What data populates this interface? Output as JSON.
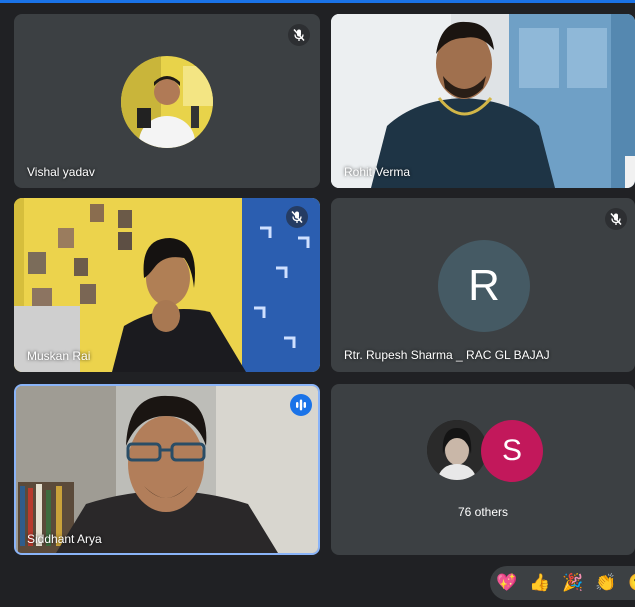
{
  "participants": {
    "vishal": {
      "name": "Vishal yadav",
      "muted": true
    },
    "rohit": {
      "name": "Rohit Verma"
    },
    "muskan": {
      "name": "Muskan Rai",
      "muted": true
    },
    "rupesh": {
      "name": "Rtr. Rupesh Sharma _ RAC GL BAJAJ",
      "initial": "R",
      "muted": true
    },
    "siddhant": {
      "name": "Siddhant Arya",
      "speaking": true
    },
    "others": {
      "initial": "S",
      "label": "76 others"
    }
  },
  "reactions": [
    "💖",
    "👍",
    "🎉",
    "👏",
    "😮"
  ],
  "colors": {
    "background": "#202124",
    "tile": "#3c4043",
    "active_border": "#8ab4f8",
    "avatar_R": "#455a64",
    "avatar_S": "#c2185b"
  }
}
